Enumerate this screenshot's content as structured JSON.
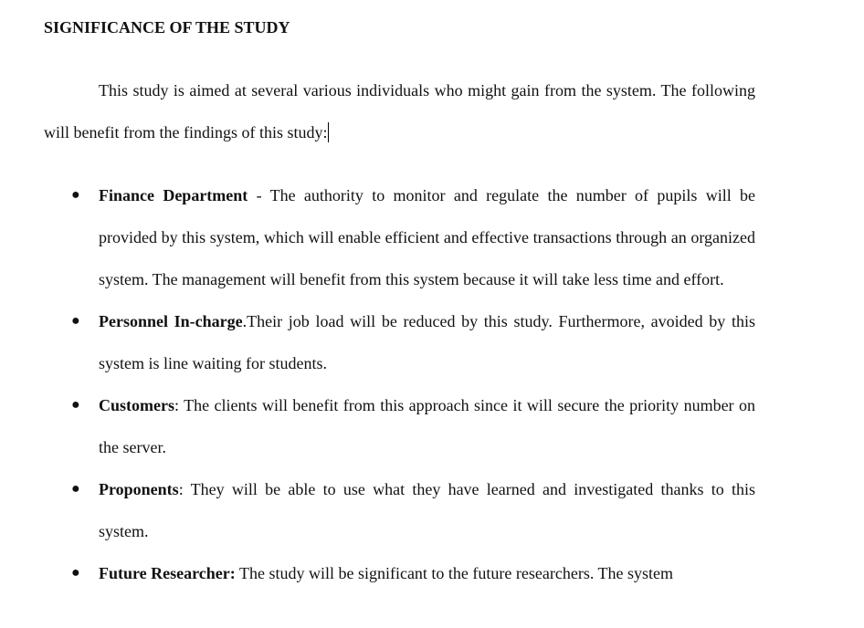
{
  "document": {
    "heading": "SIGNIFICANCE OF THE STUDY",
    "intro": "This study is aimed at several various individuals who might gain from the system. The following will benefit from the findings of this study:",
    "bullet_glyph": "●",
    "items": [
      {
        "term": "Finance Department",
        "text": " - The authority to monitor and regulate the number of pupils will be provided by this system, which will enable efficient and effective transactions through an organized system. The management will benefit from this system because it will take less time and effort."
      },
      {
        "term": "Personnel In-charge",
        "text": ".Their job load will be reduced by this study. Furthermore, avoided by this system is line waiting for students."
      },
      {
        "term": "Customers",
        "text": ": The clients will benefit from this approach since it will secure the priority number on the server."
      },
      {
        "term": "Proponents",
        "text": ": They will be able to use what they have learned and investigated thanks to this system."
      },
      {
        "term": "Future Researcher:",
        "text": " The study will be significant to the future researchers. The system"
      }
    ]
  }
}
